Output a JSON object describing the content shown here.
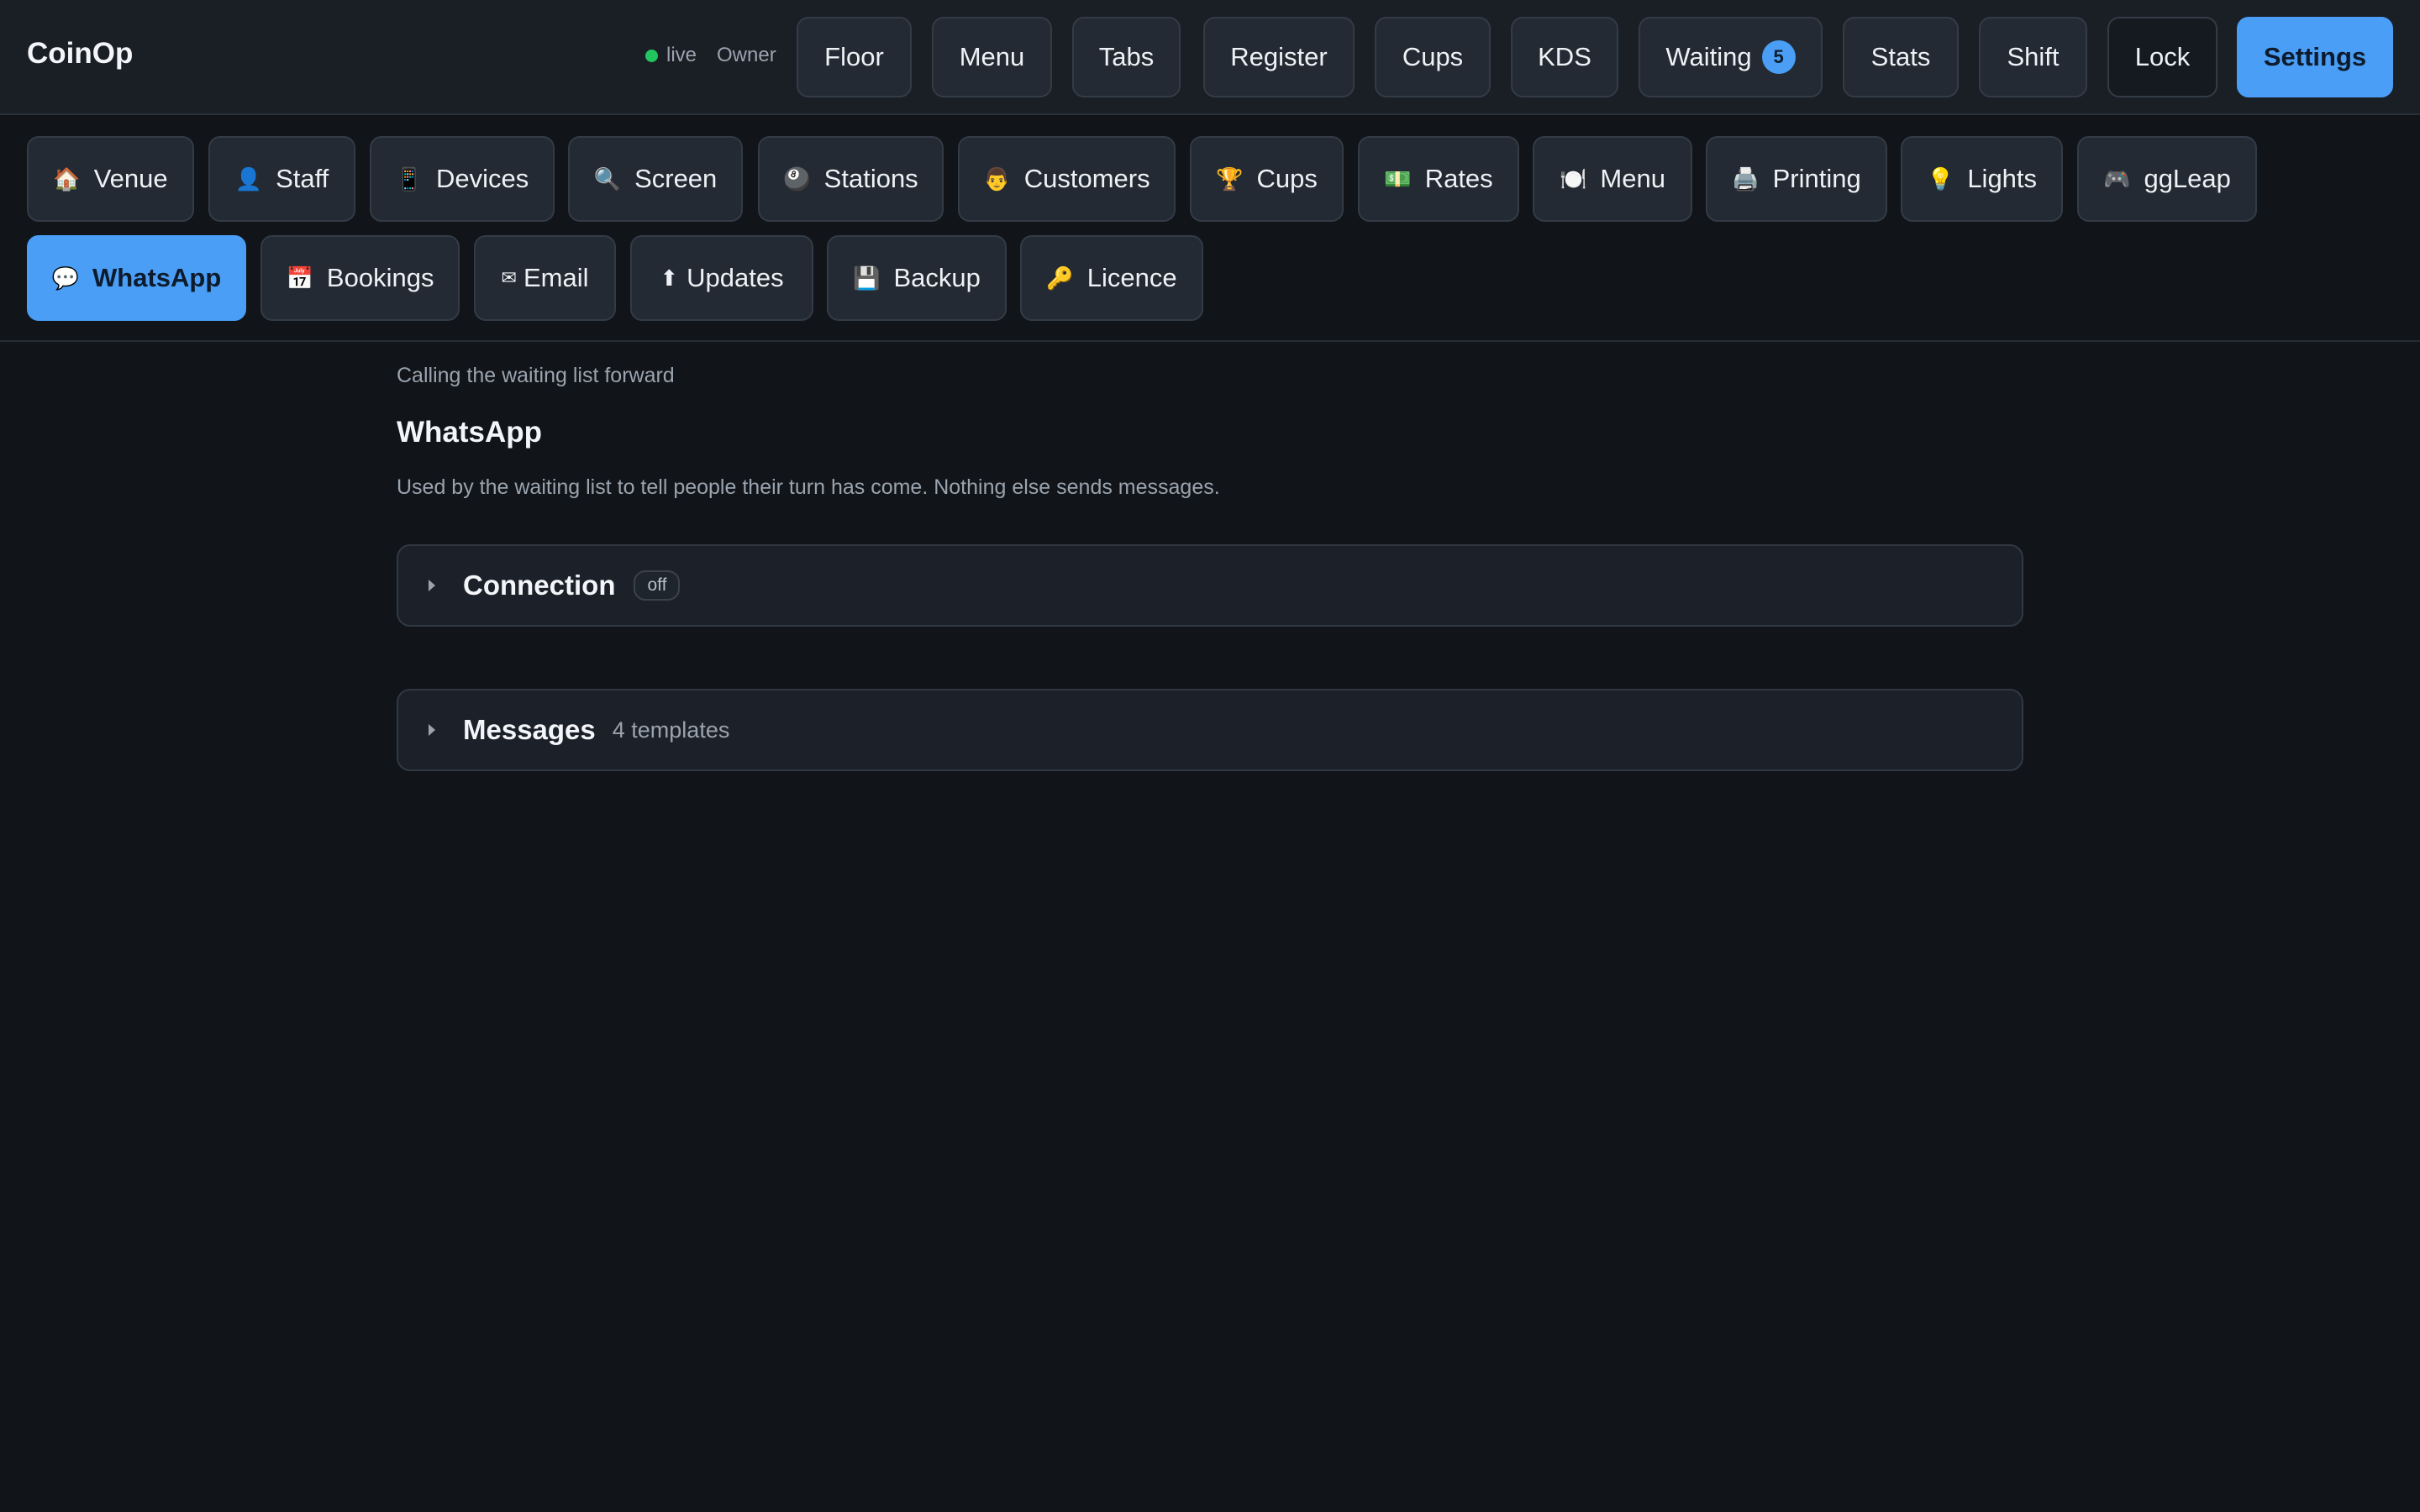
{
  "app": {
    "title": "CoinOp",
    "status": "live",
    "role": "Owner"
  },
  "topnav": {
    "floor": "Floor",
    "menu": "Menu",
    "tabs": "Tabs",
    "register": "Register",
    "cups": "Cups",
    "kds": "KDS",
    "waiting": "Waiting",
    "waiting_count": "5",
    "stats": "Stats",
    "shift": "Shift",
    "lock": "Lock",
    "settings": "Settings",
    "active": "Settings"
  },
  "settings_tabs": [
    {
      "icon": "🏠",
      "label": "Venue"
    },
    {
      "icon": "👤",
      "label": "Staff"
    },
    {
      "icon": "📱",
      "label": "Devices"
    },
    {
      "icon": "🔍",
      "label": "Screen"
    },
    {
      "icon": "🎱",
      "label": "Stations"
    },
    {
      "icon": "👨",
      "label": "Customers"
    },
    {
      "icon": "🏆",
      "label": "Cups"
    },
    {
      "icon": "💵",
      "label": "Rates"
    },
    {
      "icon": "🍽️",
      "label": "Menu"
    },
    {
      "icon": "🖨️",
      "label": "Printing"
    },
    {
      "icon": "💡",
      "label": "Lights"
    },
    {
      "icon": "🎮",
      "label": "ggLeap"
    },
    {
      "icon": "💬",
      "label": "WhatsApp"
    },
    {
      "icon": "📅",
      "label": "Bookings"
    },
    {
      "icon": "✉",
      "label": "Email"
    },
    {
      "icon": "⬆",
      "label": "Updates"
    },
    {
      "icon": "💾",
      "label": "Backup"
    },
    {
      "icon": "🔑",
      "label": "Licence"
    }
  ],
  "active_tab": "WhatsApp",
  "page": {
    "breadcrumb": "Calling the waiting list forward",
    "title": "WhatsApp",
    "description": "Used by the waiting list to tell people their turn has come. Nothing else sends messages."
  },
  "sections": {
    "connection": {
      "title": "Connection",
      "status": "off"
    },
    "messages": {
      "title": "Messages",
      "count": "4 templates"
    }
  },
  "colors": {
    "accent": "#4a9ef5",
    "background": "#111519",
    "live_dot": "#22c55e"
  }
}
